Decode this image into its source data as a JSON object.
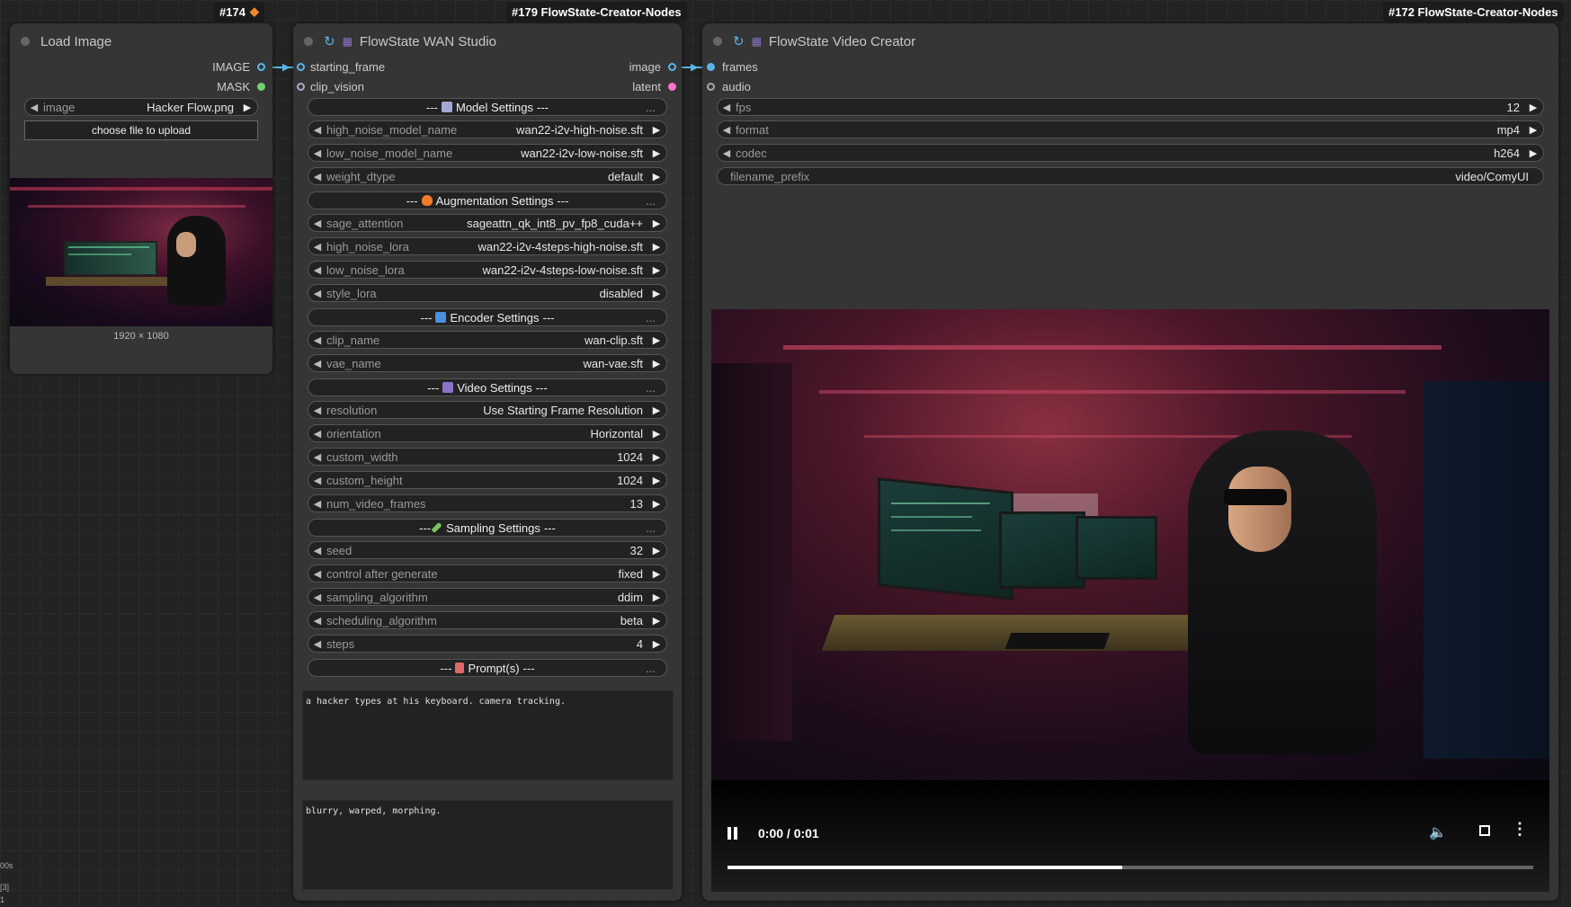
{
  "canvas": {
    "left_readout": [
      "00s",
      "[3]",
      "1"
    ]
  },
  "load_image": {
    "badge": "#174",
    "title": "Load Image",
    "outputs": [
      "IMAGE",
      "MASK"
    ],
    "image_widget": {
      "name": "image",
      "value": "Hacker Flow.png"
    },
    "upload_label": "choose file to upload",
    "dims": "1920 × 1080"
  },
  "wan": {
    "badge": "#179 FlowState-Creator-Nodes",
    "title": "FlowState WAN Studio",
    "inputs": [
      "starting_frame",
      "clip_vision"
    ],
    "outputs": [
      "image",
      "latent"
    ],
    "sections": {
      "model": "Model Settings",
      "augmentation": "Augmentation Settings",
      "encoder": "Encoder Settings",
      "video": "Video Settings",
      "sampling": "Sampling Settings",
      "prompts": "Prompt(s)"
    },
    "model_widgets": [
      {
        "name": "high_noise_model_name",
        "value": "wan22-i2v-high-noise.sft"
      },
      {
        "name": "low_noise_model_name",
        "value": "wan22-i2v-low-noise.sft"
      },
      {
        "name": "weight_dtype",
        "value": "default"
      }
    ],
    "aug_widgets": [
      {
        "name": "sage_attention",
        "value": "sageattn_qk_int8_pv_fp8_cuda++"
      },
      {
        "name": "high_noise_lora",
        "value": "wan22-i2v-4steps-high-noise.sft"
      },
      {
        "name": "low_noise_lora",
        "value": "wan22-i2v-4steps-low-noise.sft"
      },
      {
        "name": "style_lora",
        "value": "disabled"
      }
    ],
    "enc_widgets": [
      {
        "name": "clip_name",
        "value": "wan-clip.sft"
      },
      {
        "name": "vae_name",
        "value": "wan-vae.sft"
      }
    ],
    "video_widgets": [
      {
        "name": "resolution",
        "value": "Use Starting Frame Resolution"
      },
      {
        "name": "orientation",
        "value": "Horizontal"
      },
      {
        "name": "custom_width",
        "value": "1024"
      },
      {
        "name": "custom_height",
        "value": "1024"
      },
      {
        "name": "num_video_frames",
        "value": "13"
      }
    ],
    "sampling_widgets": [
      {
        "name": "seed",
        "value": "32"
      },
      {
        "name": "control after generate",
        "value": "fixed"
      },
      {
        "name": "sampling_algorithm",
        "value": "ddim"
      },
      {
        "name": "scheduling_algorithm",
        "value": "beta"
      },
      {
        "name": "steps",
        "value": "4"
      }
    ],
    "positive_prompt": "a hacker types at his keyboard. camera tracking.",
    "negative_prompt": "blurry, warped, morphing."
  },
  "video": {
    "badge": "#172 FlowState-Creator-Nodes",
    "title": "FlowState Video Creator",
    "inputs": [
      "frames",
      "audio"
    ],
    "widgets": [
      {
        "name": "fps",
        "value": "12"
      },
      {
        "name": "format",
        "value": "mp4"
      },
      {
        "name": "codec",
        "value": "h264"
      },
      {
        "name": "filename_prefix",
        "value": "video/ComyUI"
      }
    ],
    "player": {
      "time": "0:00 / 0:01",
      "progress": 0.49
    }
  },
  "colors": {
    "link": "#5bb5ea",
    "latent": "#ff72d0",
    "mask": "#6fd36f"
  },
  "icons": [
    "pause-icon",
    "volume-icon",
    "fullscreen-icon",
    "more-vert-icon",
    "refresh-icon",
    "clapper-icon"
  ]
}
